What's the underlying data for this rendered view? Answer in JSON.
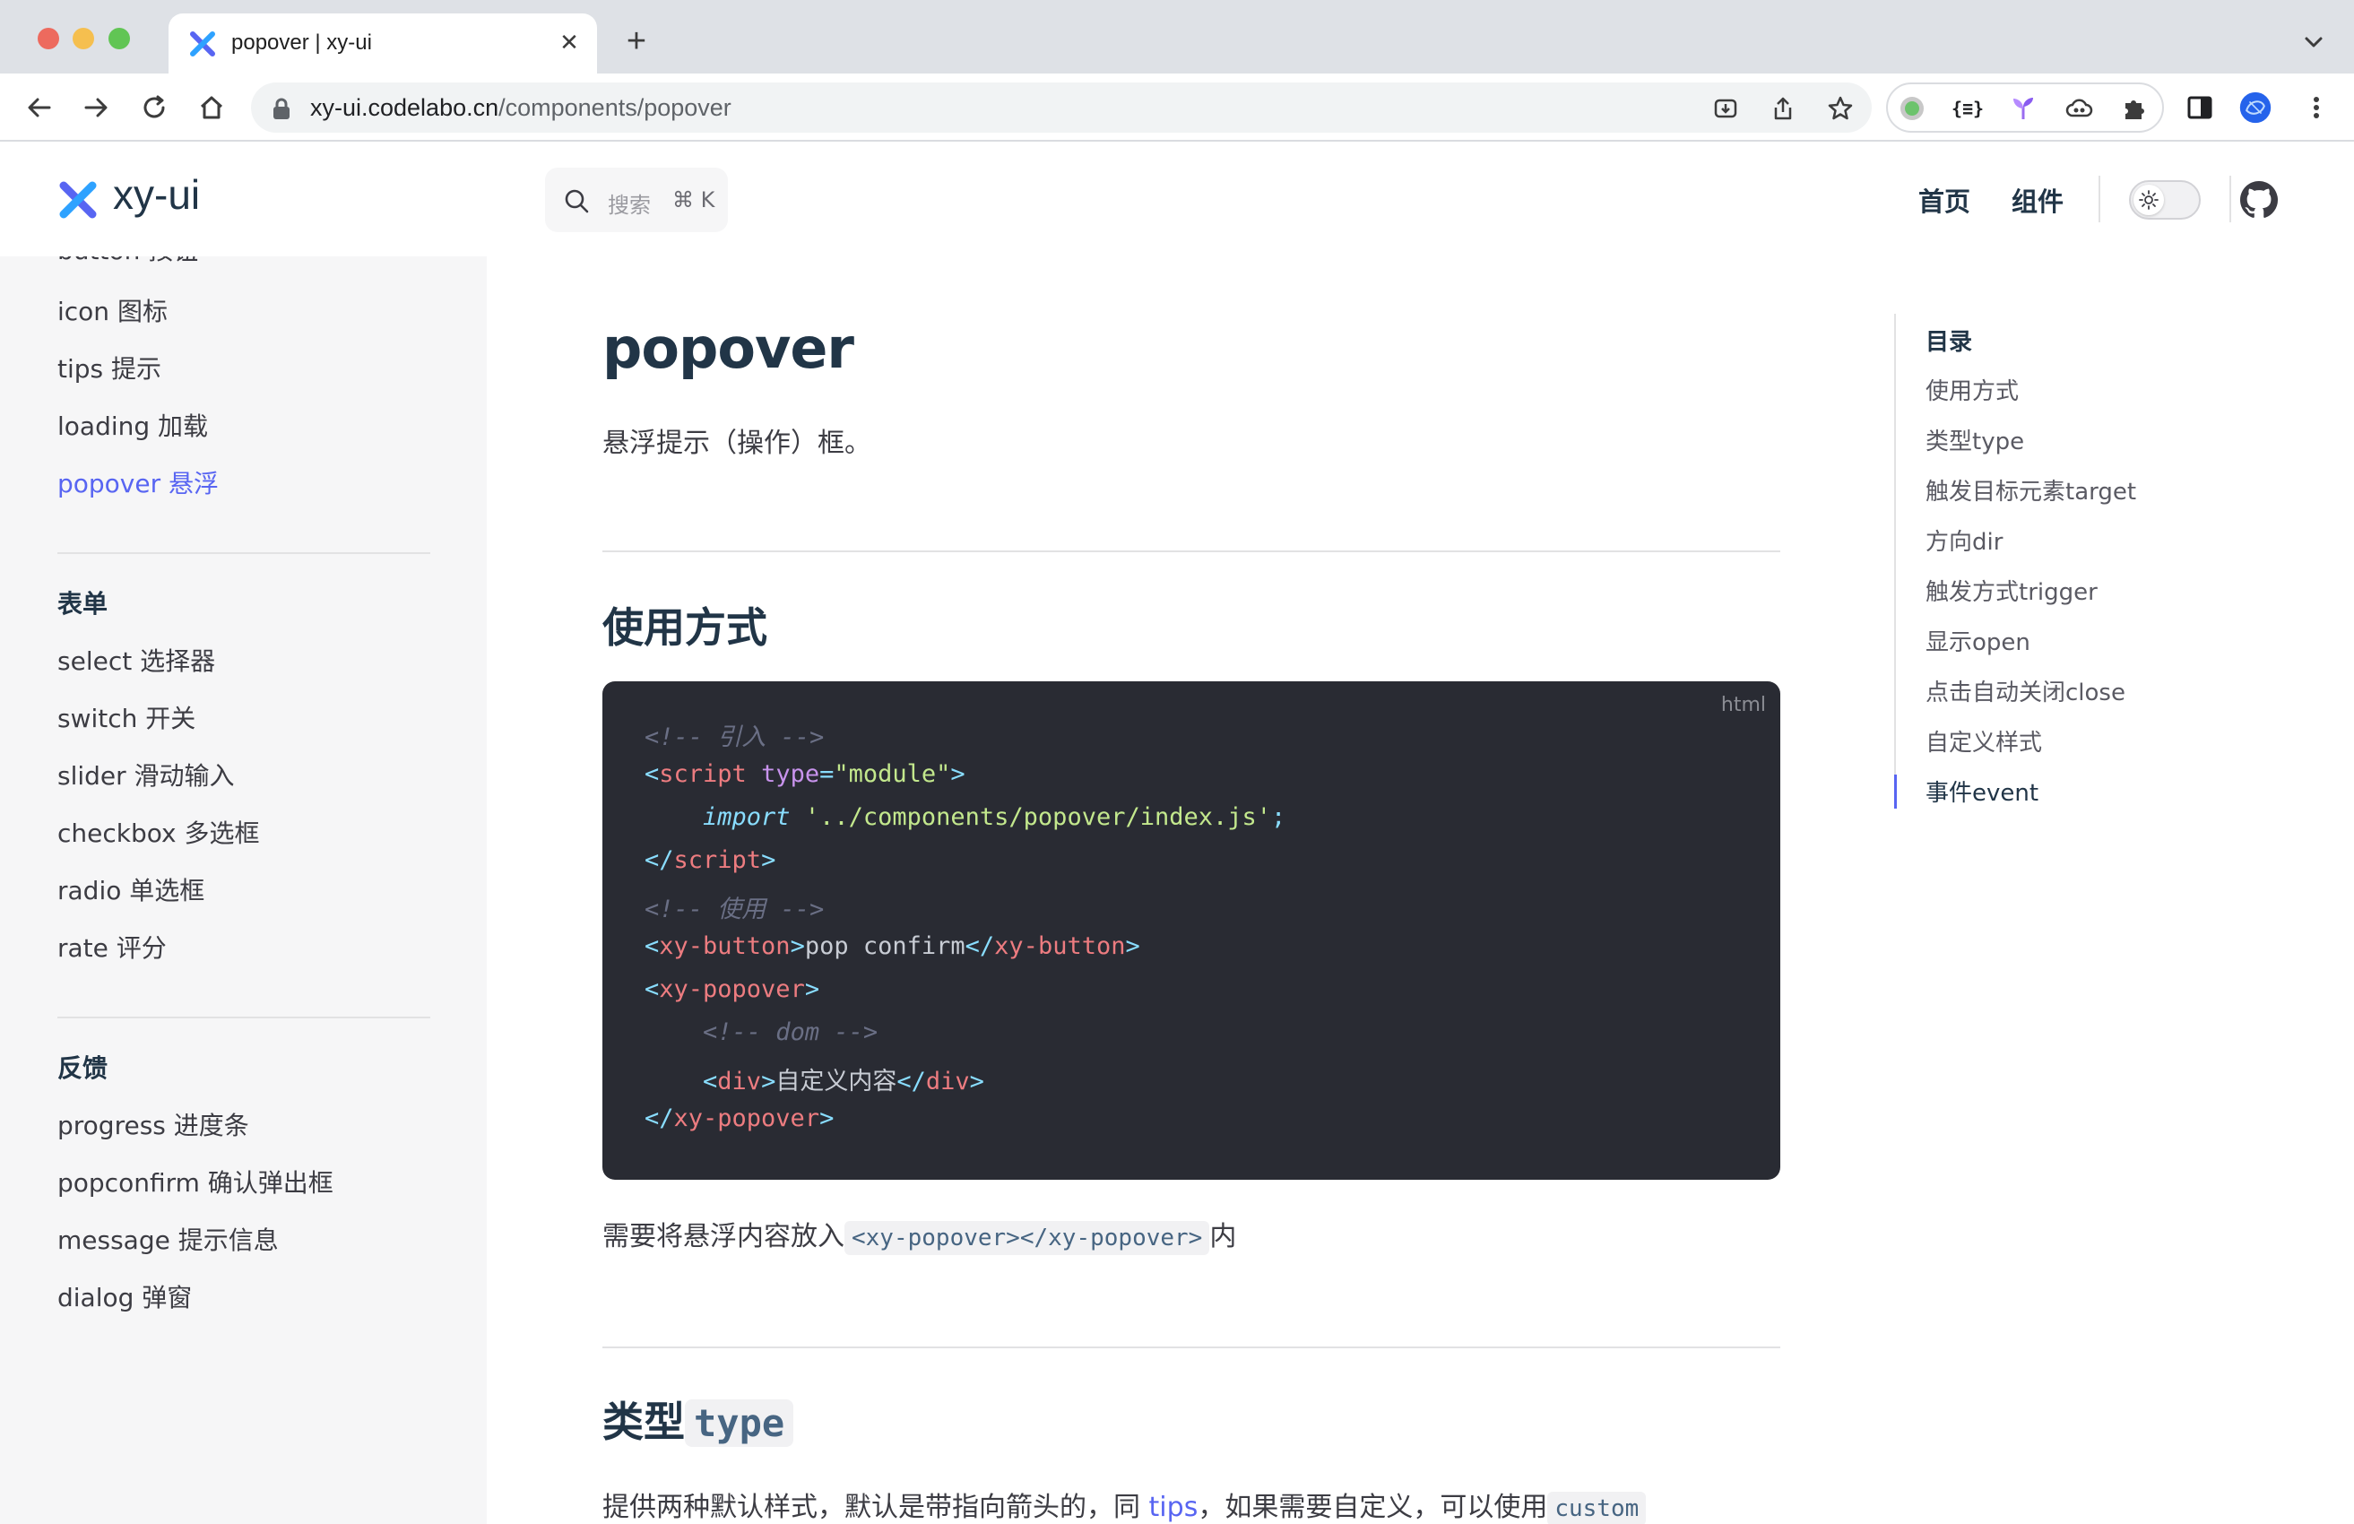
{
  "browser": {
    "tab_title": "popover | xy-ui",
    "tab_close": "✕",
    "new_tab": "+",
    "url_host": "xy-ui.codelabo.cn",
    "url_path": "/components/popover",
    "icons": [
      "back-icon",
      "forward-icon",
      "reload-icon",
      "home-icon",
      "lock-icon",
      "install-icon",
      "share-icon",
      "bookmark-star-icon",
      "extension-green-dot-icon",
      "extension-json-icon",
      "extension-sprout-icon",
      "extension-cloud-icon",
      "extensions-puzzle-icon",
      "side-panel-icon",
      "profile-avatar-icon",
      "kebab-menu-icon"
    ],
    "json_ext_label": "{≡}"
  },
  "site": {
    "brand": "xy-ui",
    "search": {
      "placeholder": "搜索",
      "shortcut": "⌘ K"
    },
    "nav": {
      "home": "首页",
      "components": "组件"
    },
    "accent": "#5865f2"
  },
  "sidebar": {
    "partial_item": "button 按钮",
    "items_top": [
      {
        "label": "icon 图标",
        "active": false
      },
      {
        "label": "tips 提示",
        "active": false
      },
      {
        "label": "loading 加载",
        "active": false
      },
      {
        "label": "popover 悬浮",
        "active": true
      }
    ],
    "groups": [
      {
        "title": "表单",
        "items": [
          "select 选择器",
          "switch 开关",
          "slider 滑动输入",
          "checkbox 多选框",
          "radio 单选框",
          "rate 评分"
        ]
      },
      {
        "title": "反馈",
        "items": [
          "progress 进度条",
          "popconfirm 确认弹出框",
          "message 提示信息",
          "dialog 弹窗"
        ]
      }
    ]
  },
  "content": {
    "title": "popover",
    "lead": "悬浮提示（操作）框。",
    "section_usage": "使用方式",
    "code_lang": "html",
    "code": {
      "l1": "<!-- 引入 -->",
      "l2_open": "<",
      "l2_tag": "script",
      "l2_attr": "type",
      "l2_eq": "=",
      "l2_val": "\"module\"",
      "l2_close": ">",
      "l3_kw": "import",
      "l3_str": "'../components/popover/index.js'",
      "l3_semi": ";",
      "l4_open": "</",
      "l4_tag": "script",
      "l4_close": ">",
      "l5": "<!-- 使用 -->",
      "l6_tag": "xy-button",
      "l6_text": "pop confirm",
      "l7_tag": "xy-popover",
      "l8": "<!-- dom -->",
      "l9_tag": "div",
      "l9_text": "自定义内容",
      "l10_tag": "xy-popover"
    },
    "note_prefix": "需要将悬浮内容放入",
    "note_code": "<xy-popover></xy-popover>",
    "note_suffix": "内",
    "section_type_text": "类型",
    "section_type_code": "type",
    "type_para_prefix": "提供两种默认样式，默认是带指向箭头的，同",
    "type_para_link": "tips",
    "type_para_middle": "，如果需要自定义，可以使用",
    "type_para_code": "custom"
  },
  "toc": {
    "title": "目录",
    "items": [
      {
        "label": "使用方式",
        "active": false
      },
      {
        "label": "类型type",
        "active": false
      },
      {
        "label": "触发目标元素target",
        "active": false
      },
      {
        "label": "方向dir",
        "active": false
      },
      {
        "label": "触发方式trigger",
        "active": false
      },
      {
        "label": "显示open",
        "active": false
      },
      {
        "label": "点击自动关闭close",
        "active": false
      },
      {
        "label": "自定义样式",
        "active": false
      },
      {
        "label": "事件event",
        "active": true
      }
    ]
  }
}
